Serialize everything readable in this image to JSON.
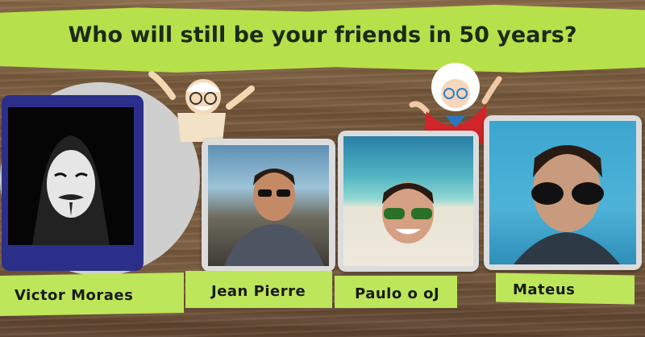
{
  "title": "Who will still be your friends in 50 years?",
  "friends": [
    {
      "name": "Victor Moraes"
    },
    {
      "name": "Jean Pierre"
    },
    {
      "name": "Paulo o oJ"
    },
    {
      "name": "Mateus"
    }
  ],
  "colors": {
    "banner": "#b7e14a",
    "label_strip": "#bde65a",
    "frame_blue": "#2b2f8a"
  }
}
